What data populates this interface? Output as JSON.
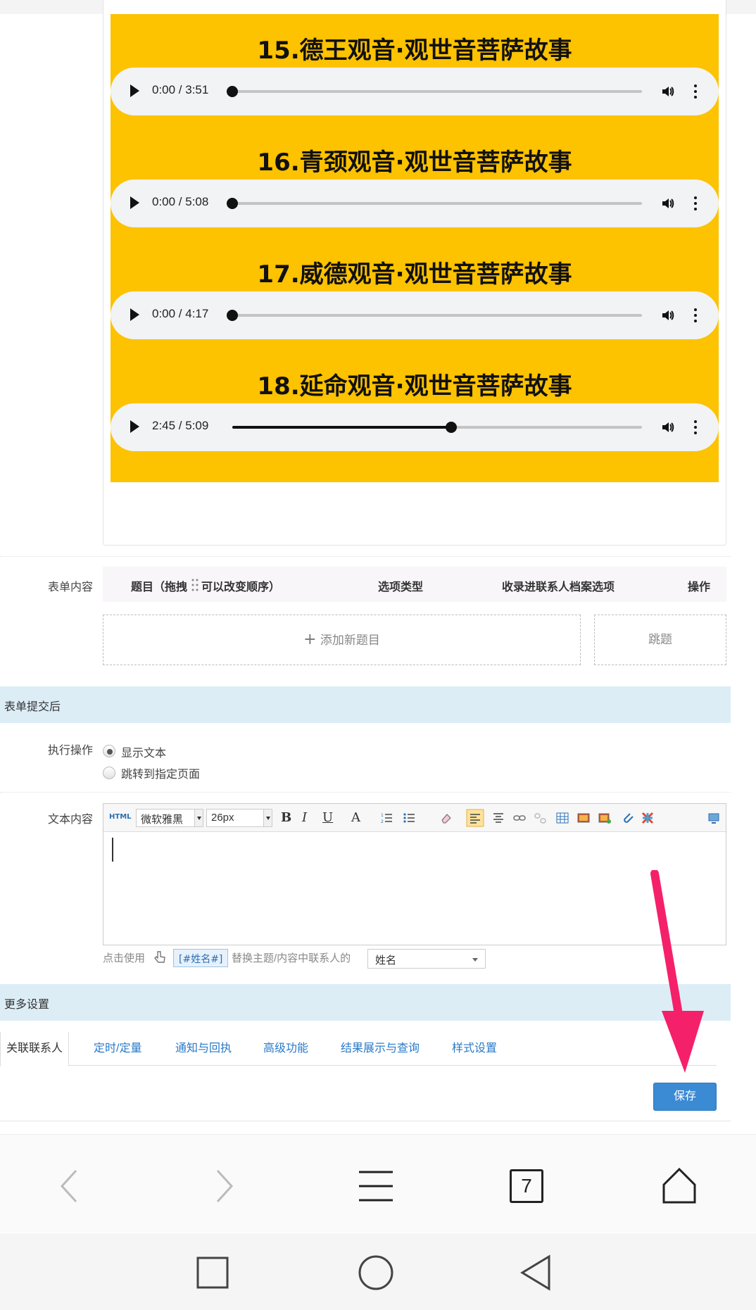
{
  "audio_items": [
    {
      "title": "15.德王观音·观世音菩萨故事",
      "time": "0:00 / 3:51",
      "progress": 0.0
    },
    {
      "title": "16.青颈观音·观世音菩萨故事",
      "time": "0:00 / 5:08",
      "progress": 0.0
    },
    {
      "title": "17.威德观音·观世音菩萨故事",
      "time": "0:00 / 4:17",
      "progress": 0.0
    },
    {
      "title": "18.延命观音·观世音菩萨故事",
      "time": "2:45 / 5:09",
      "progress": 0.534
    }
  ],
  "form_content": {
    "label": "表单内容",
    "columns": [
      "题目（拖拽",
      "可以改变顺序）",
      "选项类型",
      "收录进联系人档案选项",
      "操作"
    ],
    "add_question": "添加新题目",
    "jump": "跳题"
  },
  "after_submit": {
    "section_title": "表单提交后",
    "action_label": "执行操作",
    "options": [
      "显示文本",
      "跳转到指定页面"
    ],
    "selected": "显示文本"
  },
  "text_content": {
    "label": "文本内容",
    "font_family": "微软雅黑",
    "font_size": "26px",
    "html_label": "HTML",
    "bold": "B",
    "italic": "I",
    "underline": "U",
    "font_color": "A"
  },
  "hint": {
    "prefix": "点击使用",
    "tag": "[#姓名#]",
    "suffix": "替换主题/内容中联系人的",
    "field": "姓名"
  },
  "more_settings": {
    "section_title": "更多设置",
    "tabs": [
      "关联联系人",
      "定时/定量",
      "通知与回执",
      "高级功能",
      "结果展示与查询",
      "样式设置"
    ],
    "active_tab": "关联联系人"
  },
  "save_label": "保存",
  "browser_nav": {
    "tab_count": "7"
  },
  "colors": {
    "banner": "#fdc200",
    "section_bar": "#dcedf6",
    "save_button": "#3b8ad4",
    "annotation_arrow": "#f5206a"
  }
}
